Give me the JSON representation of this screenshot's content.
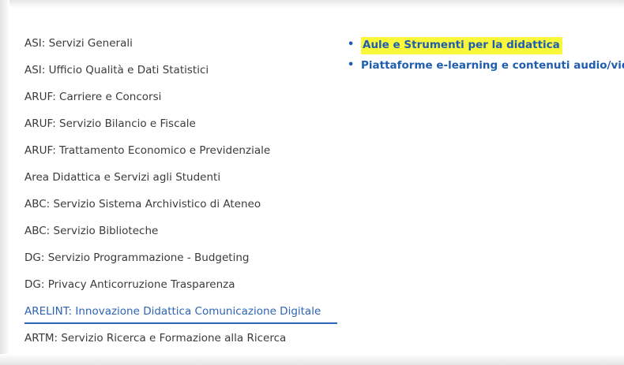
{
  "left_menu": {
    "items": [
      {
        "label": "ASI: Servizi Generali"
      },
      {
        "label": "ASI: Ufficio Qualità e Dati Statistici"
      },
      {
        "label": "ARUF: Carriere e Concorsi"
      },
      {
        "label": "ARUF: Servizio Bilancio e Fiscale"
      },
      {
        "label": "ARUF: Trattamento Economico e Previdenziale"
      },
      {
        "label": "Area Didattica e Servizi agli Studenti"
      },
      {
        "label": "ABC: Servizio Sistema Archivistico di Ateneo"
      },
      {
        "label": "ABC: Servizio Biblioteche"
      },
      {
        "label": "DG: Servizio Programmazione - Budgeting"
      },
      {
        "label": "DG: Privacy Anticorruzione Trasparenza"
      },
      {
        "label": "ARELINT: Innovazione Didattica Comunicazione Digitale"
      },
      {
        "label": "ARTM: Servizio Ricerca e Formazione alla Ricerca"
      }
    ],
    "active_index": 10
  },
  "right_links": {
    "items": [
      {
        "label": "Aule e Strumenti per la didattica",
        "highlighted": true
      },
      {
        "label": "Piattaforme e-learning e contenuti audio/video",
        "highlighted": false
      }
    ],
    "bullet": "•"
  },
  "colors": {
    "link": "#1f5db0",
    "active": "#2d64b8",
    "text": "#3b3b3b",
    "highlight": "#f9f73a"
  }
}
